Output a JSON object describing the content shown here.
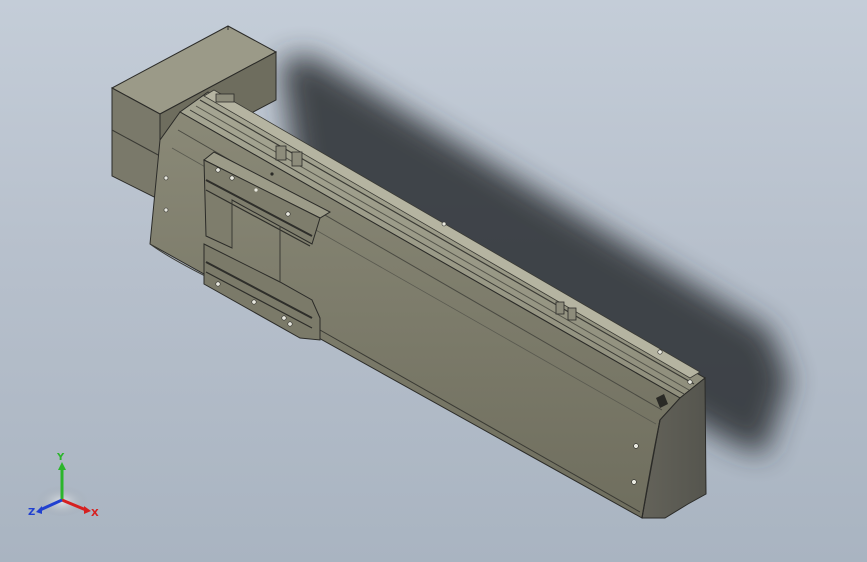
{
  "view": {
    "background_top": "#c4cdd8",
    "background_bottom": "#a9b4c1",
    "model_color": "#7d7c6a"
  },
  "triad": {
    "y_label": "Y",
    "x_label": "X",
    "z_label": "Z",
    "y_color": "#2bb52b",
    "x_color": "#d62020",
    "z_color": "#2040d0"
  }
}
